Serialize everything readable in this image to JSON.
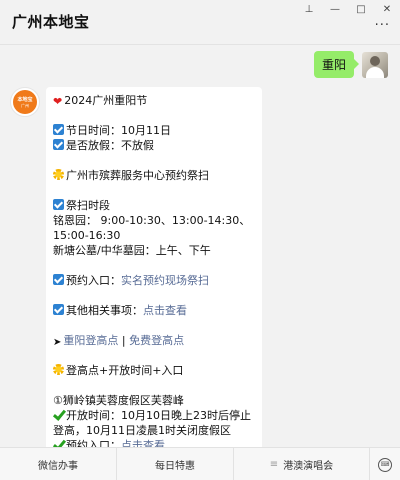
{
  "window": {
    "title": "广州本地宝",
    "controls": {
      "pin": "⊥",
      "minimize": "—",
      "maximize": "□",
      "close": "✕"
    },
    "more": "···"
  },
  "chat": {
    "outgoing": {
      "text": "重阳",
      "bubble_color": "#95ec69"
    },
    "bot_avatar": {
      "line1": "本地宝",
      "line2": "广州",
      "color": "#f07a1a"
    },
    "message": {
      "l1": "2024广州重阳节",
      "l2": "节日时间：10月11日",
      "l3": "是否放假：不放假",
      "l4": "广州市殡葬服务中心预约祭扫",
      "l5": "祭扫时段",
      "l6": "铭恩园：  9:00-10:30、13:00-14:30、15:00-16:30",
      "l7": "新塘公墓/中华墓园：上午、下午",
      "l8_label": "预约入口：",
      "l8_link": "实名预约现场祭扫",
      "l9_label": "其他相关事项：",
      "l9_link": "点击查看",
      "l10_link1": "重阳登高点",
      "l10_sep": " | ",
      "l10_link2": "免费登高点",
      "l11": "登高点+开放时间+入口",
      "l12": "①狮岭镇芙蓉度假区芙蓉峰",
      "l13": "开放时间：10月10日晚上23时后停止登高，10月11日凌晨1时关闭度假区",
      "l14_label": "预约入口：",
      "l14_link": "点击查看"
    },
    "link_color": "#576b95"
  },
  "menu": {
    "items": [
      "微信办事",
      "每日特惠",
      "港澳演唱会"
    ],
    "lines_icon": "≡",
    "keyboard_icon": "keyboard-icon"
  }
}
